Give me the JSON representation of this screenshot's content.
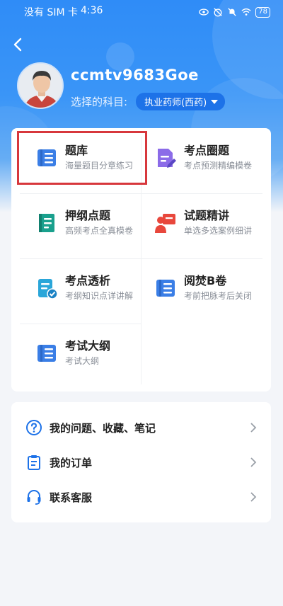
{
  "status_bar": {
    "carrier": "没有 SIM 卡",
    "time": "4:36",
    "battery": "78",
    "icons": [
      "eye-icon",
      "alarm-off-icon",
      "bell-off-icon",
      "wifi-icon"
    ]
  },
  "header": {
    "back_icon": "chevron-left-icon",
    "username": "ccmtv9683Goe",
    "subject_label": "选择的科目:",
    "subject_value": "执业药师(西药)"
  },
  "grid": {
    "tiles": [
      {
        "title": "题库",
        "subtitle": "海量题目分章练习",
        "icon": "question-bank-icon",
        "highlighted": true
      },
      {
        "title": "考点圈题",
        "subtitle": "考点预测精编模卷",
        "icon": "edit-document-icon"
      },
      {
        "title": "押纲点题",
        "subtitle": "高频考点全真模卷",
        "icon": "book-icon"
      },
      {
        "title": "试题精讲",
        "subtitle": "单选多选案例细讲",
        "icon": "teacher-icon"
      },
      {
        "title": "考点透析",
        "subtitle": "考纲知识点详讲解",
        "icon": "checklist-icon"
      },
      {
        "title": "阅焚B卷",
        "subtitle": "考前把脉考后关闭",
        "icon": "question-bank-icon"
      },
      {
        "title": "考试大纲",
        "subtitle": "考试大纲",
        "icon": "question-bank-icon"
      }
    ]
  },
  "menu": {
    "items": [
      {
        "label": "我的问题、收藏、笔记",
        "icon": "question-circle-icon"
      },
      {
        "label": "我的订单",
        "icon": "clipboard-icon"
      },
      {
        "label": "联系客服",
        "icon": "headset-icon"
      }
    ]
  },
  "colors": {
    "header_blue": "#2f8cf7",
    "accent_blue": "#1d72e8",
    "highlight_red": "#d7373c"
  }
}
